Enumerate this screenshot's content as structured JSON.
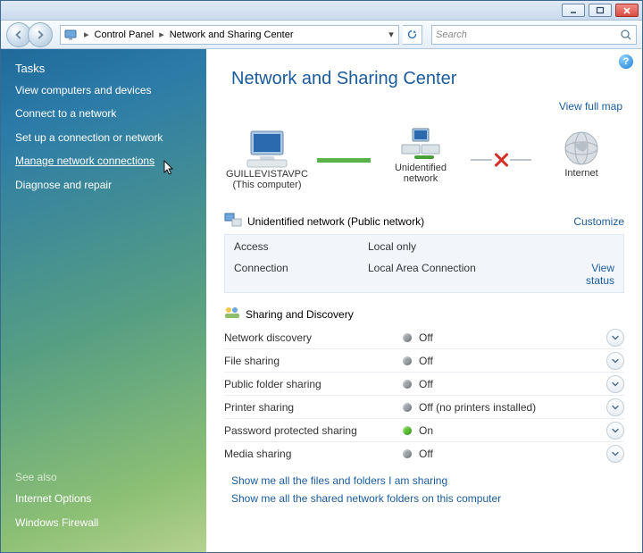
{
  "breadcrumb": {
    "item1": "Control Panel",
    "item2": "Network and Sharing Center"
  },
  "search": {
    "placeholder": "Search"
  },
  "sidebar": {
    "tasks_heading": "Tasks",
    "tasks": [
      "View computers and devices",
      "Connect to a network",
      "Set up a connection or network",
      "Manage network connections",
      "Diagnose and repair"
    ],
    "selected_index": 3,
    "seealso_heading": "See also",
    "seealso": [
      "Internet Options",
      "Windows Firewall"
    ]
  },
  "main": {
    "title": "Network and Sharing Center",
    "view_full_map": "View full map",
    "map": {
      "node1_name": "GUILLEVISTAVPC",
      "node1_sub": "(This computer)",
      "node2_name": "Unidentified network",
      "node3_name": "Internet"
    },
    "network_section_label": "Unidentified network (Public network)",
    "customize": "Customize",
    "netpanel": {
      "access_label": "Access",
      "access_value": "Local only",
      "connection_label": "Connection",
      "connection_value": "Local Area Connection",
      "view_status": "View status"
    },
    "sd_heading": "Sharing and Discovery",
    "sd": [
      {
        "name": "Network discovery",
        "value": "Off",
        "on": false
      },
      {
        "name": "File sharing",
        "value": "Off",
        "on": false
      },
      {
        "name": "Public folder sharing",
        "value": "Off",
        "on": false
      },
      {
        "name": "Printer sharing",
        "value": "Off (no printers installed)",
        "on": false
      },
      {
        "name": "Password protected sharing",
        "value": "On",
        "on": true
      },
      {
        "name": "Media sharing",
        "value": "Off",
        "on": false
      }
    ],
    "bottomlinks": [
      "Show me all the files and folders I am sharing",
      "Show me all the shared network folders on this computer"
    ]
  }
}
